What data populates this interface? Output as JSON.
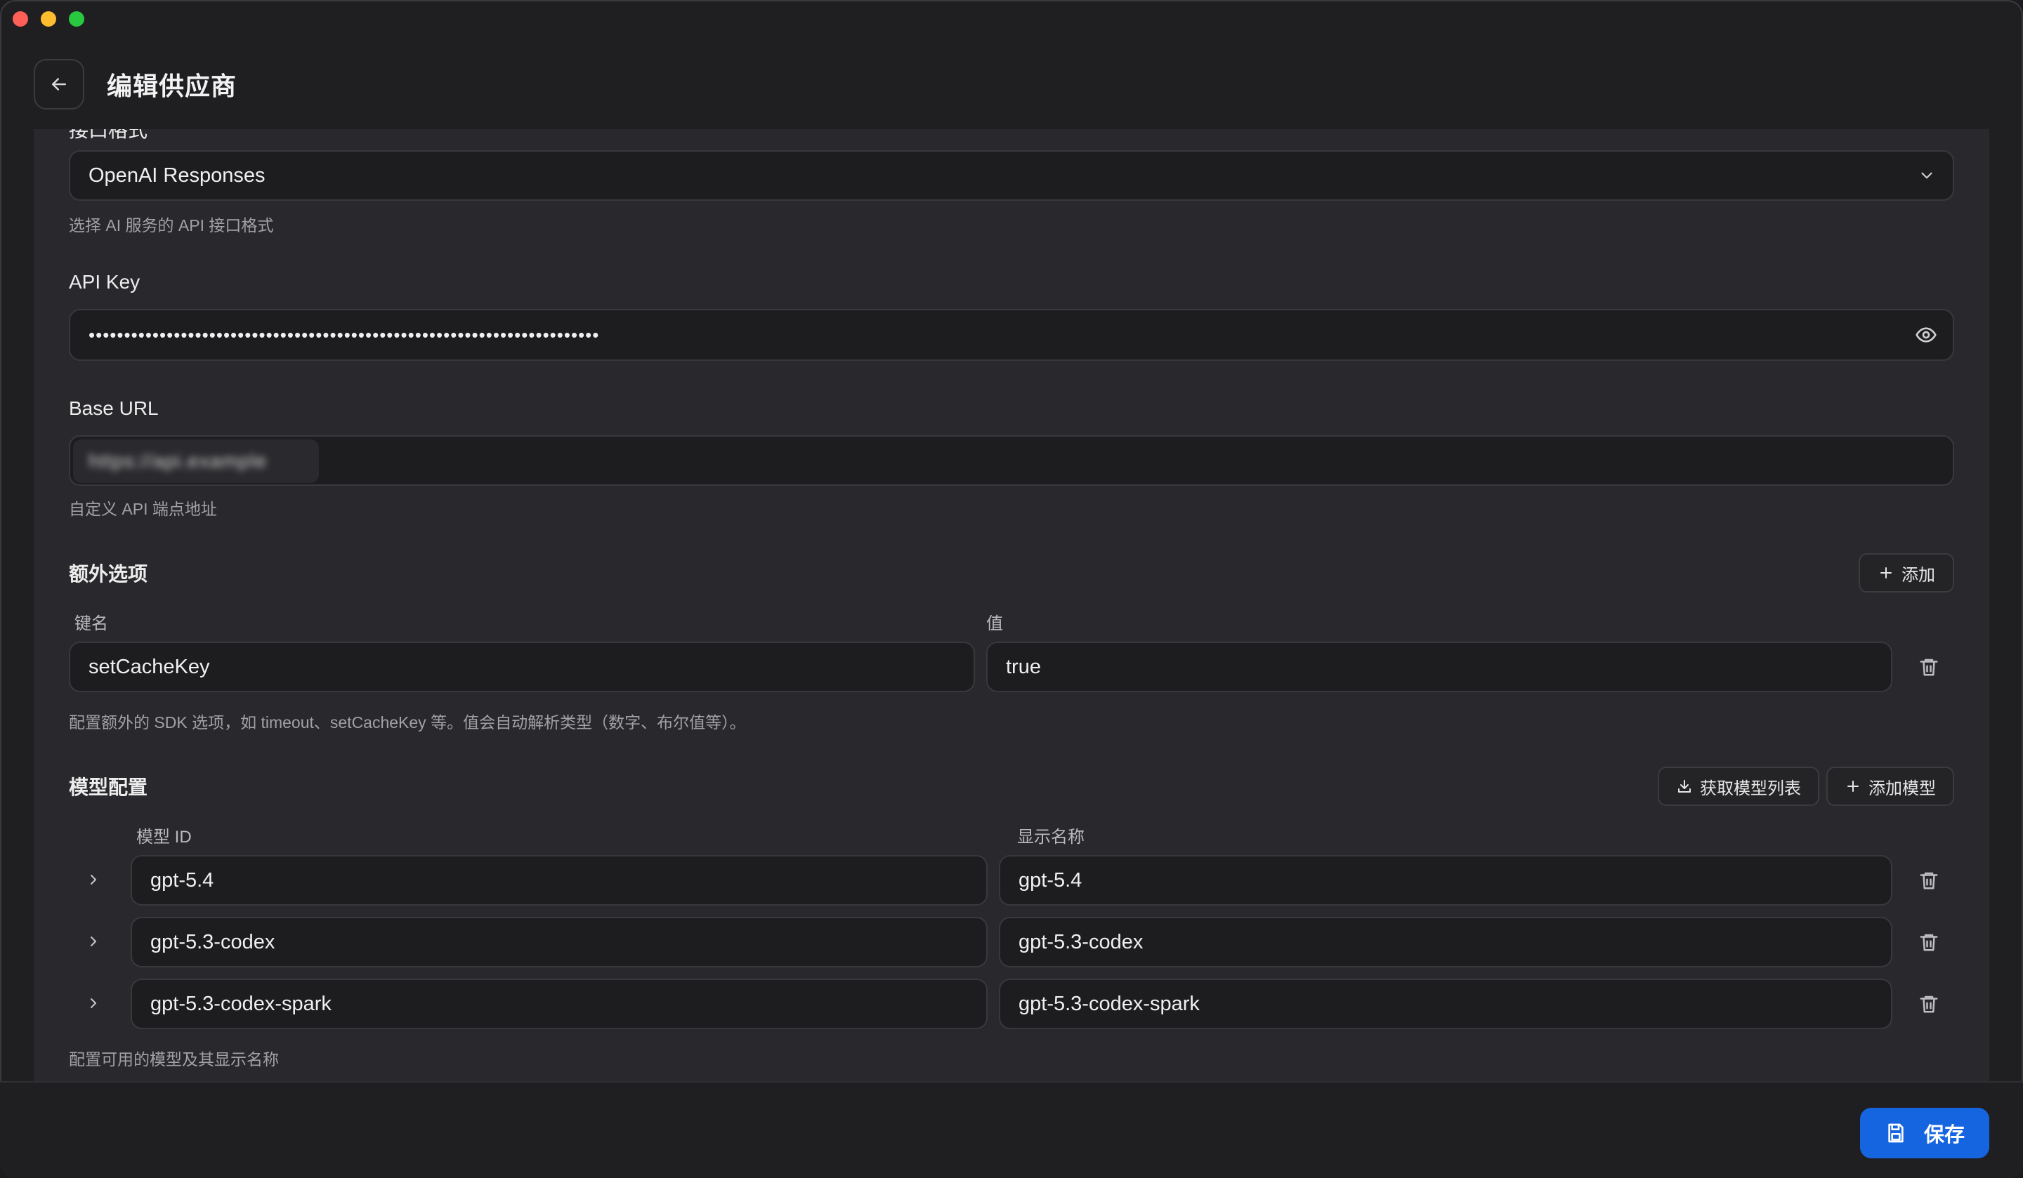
{
  "header": {
    "title": "编辑供应商"
  },
  "api_format": {
    "label": "接口格式",
    "selected": "OpenAI Responses",
    "help": "选择 AI 服务的 API 接口格式"
  },
  "api_key": {
    "label": "API Key",
    "masked_value": "••••••••••••••••••••••••••••••••••••••••••••••••••••••••••••••••••••••••"
  },
  "base_url": {
    "label": "Base URL",
    "value": "https://api.example",
    "help": "自定义 API 端点地址"
  },
  "extra_options": {
    "title": "额外选项",
    "add_label": "添加",
    "key_col": "键名",
    "value_col": "值",
    "rows": [
      {
        "key": "setCacheKey",
        "value": "true"
      }
    ],
    "help": "配置额外的 SDK 选项，如 timeout、setCacheKey 等。值会自动解析类型（数字、布尔值等）。"
  },
  "models": {
    "title": "模型配置",
    "fetch_label": "获取模型列表",
    "add_label": "添加模型",
    "id_col": "模型 ID",
    "name_col": "显示名称",
    "rows": [
      {
        "id": "gpt-5.4",
        "name": "gpt-5.4"
      },
      {
        "id": "gpt-5.3-codex",
        "name": "gpt-5.3-codex"
      },
      {
        "id": "gpt-5.3-codex-spark",
        "name": "gpt-5.3-codex-spark"
      }
    ],
    "help": "配置可用的模型及其显示名称"
  },
  "footer": {
    "save_label": "保存"
  },
  "colors": {
    "accent": "#1565e0",
    "panel": "#29292d",
    "input_bg": "#1d1d20"
  }
}
